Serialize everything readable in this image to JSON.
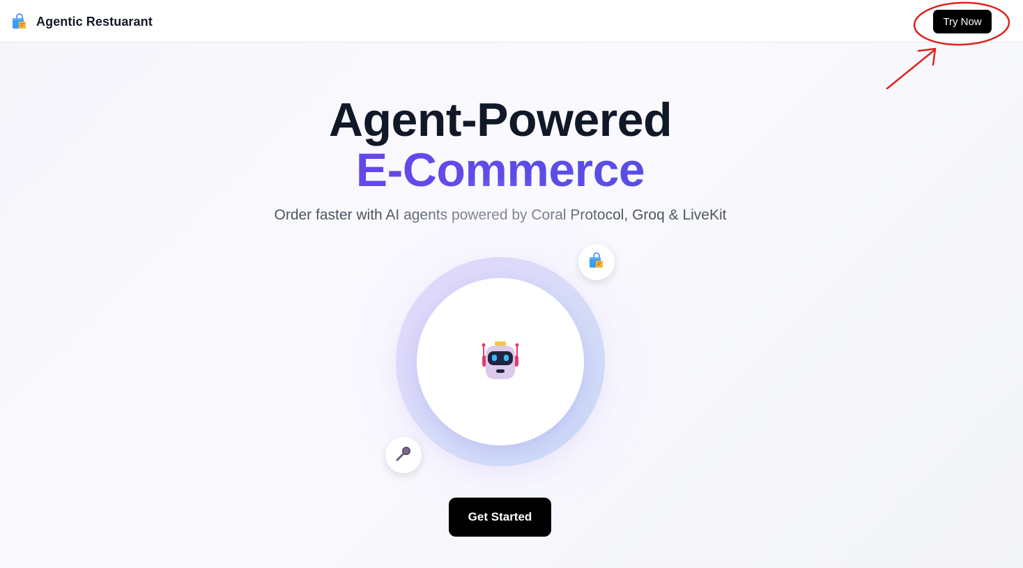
{
  "navbar": {
    "brand_name": "Agentic Restuarant",
    "brand_icon": "shopping-bag-icon",
    "try_now_label": "Try Now"
  },
  "hero": {
    "title_line1": "Agent-Powered",
    "title_line2": "E-Commerce",
    "subtitle": "Order faster with AI agents powered by Coral Protocol, Groq & LiveKit",
    "center_icon": "robot-icon",
    "floating_icons": [
      "shopping-bag-icon",
      "microphone-icon"
    ],
    "cta_label": "Get Started"
  },
  "colors": {
    "accent_start": "#7c3aed",
    "accent_end": "#4f46e5",
    "button_bg": "#000000",
    "annotation": "#e0201b"
  }
}
